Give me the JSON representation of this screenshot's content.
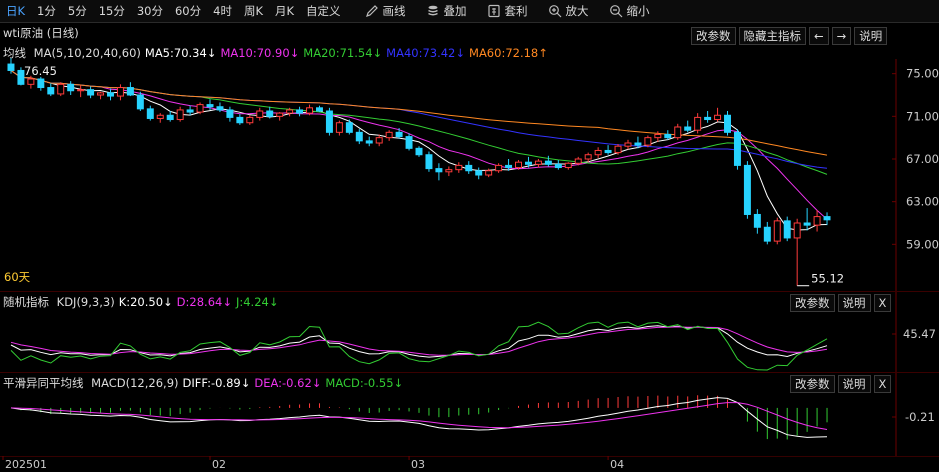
{
  "toolbar": {
    "items": [
      {
        "label": "日K",
        "active": true
      },
      {
        "label": "1分"
      },
      {
        "label": "5分"
      },
      {
        "label": "15分"
      },
      {
        "label": "30分"
      },
      {
        "label": "60分"
      },
      {
        "label": "4时"
      },
      {
        "label": "周K"
      },
      {
        "label": "月K"
      },
      {
        "label": "自定义"
      }
    ],
    "tools": [
      {
        "label": "画线",
        "icon": "pencil-icon"
      },
      {
        "label": "叠加",
        "icon": "stack-icon"
      },
      {
        "label": "套利",
        "icon": "arbitrage-icon"
      },
      {
        "label": "放大",
        "icon": "zoom-in-icon"
      },
      {
        "label": "缩小",
        "icon": "zoom-out-icon"
      }
    ]
  },
  "main_panel": {
    "title": "wti原油 (日线)",
    "buttons": {
      "params": "改参数",
      "hide": "隐藏主指标",
      "prev": "←",
      "next": "→",
      "help": "说明"
    },
    "ma_label": "均线",
    "ma_items": [
      {
        "text": "MA(5,10,20,40,60)",
        "color": "#dddddd"
      },
      {
        "text": "MA5:70.34↓",
        "color": "#ffffff"
      },
      {
        "text": "MA10:70.90↓",
        "color": "#ee33ee"
      },
      {
        "text": "MA20:71.54↓",
        "color": "#33cc33"
      },
      {
        "text": "MA40:73.42↓",
        "color": "#3333ff"
      },
      {
        "text": "MA60:72.18↑",
        "color": "#ff8822"
      }
    ],
    "high_label": "76.45",
    "low_label": "55.12",
    "days_label": "60天",
    "y_ticks": [
      "75.00",
      "71.00",
      "67.00",
      "63.00",
      "59.00"
    ]
  },
  "kdj_panel": {
    "label": "随机指标",
    "items": [
      {
        "text": "KDJ(9,3,3)",
        "color": "#dddddd"
      },
      {
        "text": "K:20.50↓",
        "color": "#ffffff"
      },
      {
        "text": "D:28.64↓",
        "color": "#ee33ee"
      },
      {
        "text": "J:4.24↓",
        "color": "#33cc33"
      }
    ],
    "buttons": {
      "params": "改参数",
      "help": "说明",
      "close": "X"
    },
    "y_tick": "45.47"
  },
  "macd_panel": {
    "label": "平滑异同平均线",
    "items": [
      {
        "text": "MACD(12,26,9)",
        "color": "#dddddd"
      },
      {
        "text": "DIFF:-0.89↓",
        "color": "#ffffff"
      },
      {
        "text": "DEA:-0.62↓",
        "color": "#ee33ee"
      },
      {
        "text": "MACD:-0.55↓",
        "color": "#33cc33"
      }
    ],
    "buttons": {
      "params": "改参数",
      "help": "说明",
      "close": "X"
    },
    "y_tick": "-0.21"
  },
  "x_axis": [
    "202501",
    "02",
    "03",
    "04"
  ],
  "chart_data": {
    "type": "candlestick",
    "symbol": "wti原油",
    "period": "日线",
    "ylim": [
      55,
      76
    ],
    "candles": [
      [
        75.9,
        76.45,
        75.0,
        75.3
      ],
      [
        75.3,
        75.6,
        73.9,
        74.0
      ],
      [
        74.0,
        74.8,
        73.6,
        74.5
      ],
      [
        74.5,
        74.7,
        73.4,
        73.7
      ],
      [
        73.7,
        74.1,
        72.9,
        73.1
      ],
      [
        73.1,
        74.2,
        72.9,
        74.0
      ],
      [
        74.0,
        74.3,
        73.0,
        73.4
      ],
      [
        73.4,
        73.9,
        72.8,
        73.5
      ],
      [
        73.5,
        73.8,
        72.7,
        73.0
      ],
      [
        73.0,
        73.3,
        72.6,
        73.2
      ],
      [
        73.2,
        73.6,
        72.5,
        72.9
      ],
      [
        72.9,
        74.0,
        72.5,
        73.7
      ],
      [
        73.7,
        74.2,
        72.9,
        73.0
      ],
      [
        73.0,
        73.3,
        71.5,
        71.7
      ],
      [
        71.7,
        72.0,
        70.6,
        70.8
      ],
      [
        70.8,
        71.3,
        70.4,
        71.1
      ],
      [
        71.1,
        71.5,
        70.5,
        70.7
      ],
      [
        70.7,
        71.9,
        70.5,
        71.6
      ],
      [
        71.6,
        72.0,
        71.1,
        71.4
      ],
      [
        71.4,
        72.3,
        71.2,
        72.1
      ],
      [
        72.1,
        72.6,
        71.6,
        71.9
      ],
      [
        71.9,
        72.3,
        71.4,
        71.6
      ],
      [
        71.6,
        71.9,
        70.5,
        70.9
      ],
      [
        70.9,
        71.2,
        70.2,
        70.4
      ],
      [
        70.4,
        71.1,
        70.2,
        70.9
      ],
      [
        70.9,
        71.8,
        70.6,
        71.5
      ],
      [
        71.5,
        71.9,
        70.8,
        71.0
      ],
      [
        71.0,
        71.4,
        70.6,
        71.3
      ],
      [
        71.3,
        71.8,
        71.0,
        71.6
      ],
      [
        71.6,
        71.9,
        71.0,
        71.3
      ],
      [
        71.3,
        72.1,
        71.1,
        71.8
      ],
      [
        71.8,
        72.0,
        71.4,
        71.5
      ],
      [
        71.5,
        71.8,
        69.2,
        69.5
      ],
      [
        69.5,
        70.6,
        69.2,
        70.4
      ],
      [
        70.4,
        70.7,
        69.3,
        69.5
      ],
      [
        69.5,
        69.8,
        68.4,
        68.7
      ],
      [
        68.7,
        69.1,
        68.2,
        68.5
      ],
      [
        68.5,
        69.3,
        68.2,
        69.0
      ],
      [
        69.0,
        69.7,
        68.7,
        69.5
      ],
      [
        69.5,
        69.9,
        68.9,
        69.1
      ],
      [
        69.1,
        69.4,
        67.8,
        68.0
      ],
      [
        68.0,
        68.2,
        67.2,
        67.4
      ],
      [
        67.4,
        67.7,
        65.8,
        66.1
      ],
      [
        66.1,
        66.6,
        65.0,
        65.8
      ],
      [
        65.8,
        66.3,
        65.4,
        66.0
      ],
      [
        66.0,
        66.7,
        65.7,
        66.4
      ],
      [
        66.4,
        66.8,
        65.6,
        65.9
      ],
      [
        65.9,
        66.2,
        65.1,
        65.5
      ],
      [
        65.5,
        66.1,
        65.3,
        65.9
      ],
      [
        65.9,
        66.6,
        65.7,
        66.4
      ],
      [
        66.4,
        67.0,
        65.9,
        66.2
      ],
      [
        66.2,
        66.9,
        66.0,
        66.7
      ],
      [
        66.7,
        67.2,
        66.2,
        66.5
      ],
      [
        66.5,
        67.0,
        66.2,
        66.8
      ],
      [
        66.8,
        67.3,
        66.3,
        66.5
      ],
      [
        66.5,
        66.9,
        66.0,
        66.2
      ],
      [
        66.2,
        66.7,
        66.0,
        66.6
      ],
      [
        66.6,
        67.2,
        66.4,
        67.0
      ],
      [
        67.0,
        67.6,
        66.7,
        67.4
      ],
      [
        67.4,
        68.1,
        67.1,
        67.8
      ],
      [
        67.8,
        68.3,
        67.4,
        67.6
      ],
      [
        67.6,
        68.4,
        67.4,
        68.2
      ],
      [
        68.2,
        68.8,
        67.9,
        68.5
      ],
      [
        68.5,
        69.1,
        68.0,
        68.3
      ],
      [
        68.3,
        69.2,
        68.1,
        69.0
      ],
      [
        69.0,
        69.6,
        68.6,
        69.3
      ],
      [
        69.3,
        69.7,
        68.8,
        69.0
      ],
      [
        69.0,
        70.3,
        68.8,
        70.0
      ],
      [
        70.0,
        70.6,
        69.5,
        69.7
      ],
      [
        69.7,
        71.3,
        69.4,
        70.9
      ],
      [
        70.9,
        71.5,
        70.4,
        70.7
      ],
      [
        70.7,
        71.8,
        70.5,
        71.1
      ],
      [
        71.1,
        71.5,
        69.2,
        69.5
      ],
      [
        69.5,
        69.8,
        66.0,
        66.4
      ],
      [
        66.4,
        66.8,
        61.4,
        61.8
      ],
      [
        61.8,
        62.3,
        60.0,
        60.6
      ],
      [
        60.6,
        61.1,
        59.0,
        59.3
      ],
      [
        59.3,
        61.5,
        59.0,
        61.2
      ],
      [
        61.2,
        61.6,
        59.3,
        59.6
      ],
      [
        59.6,
        61.4,
        55.12,
        61.0
      ],
      [
        61.0,
        62.4,
        60.3,
        60.8
      ],
      [
        60.8,
        62.2,
        60.2,
        61.6
      ],
      [
        61.6,
        62.0,
        60.8,
        61.3
      ]
    ]
  }
}
